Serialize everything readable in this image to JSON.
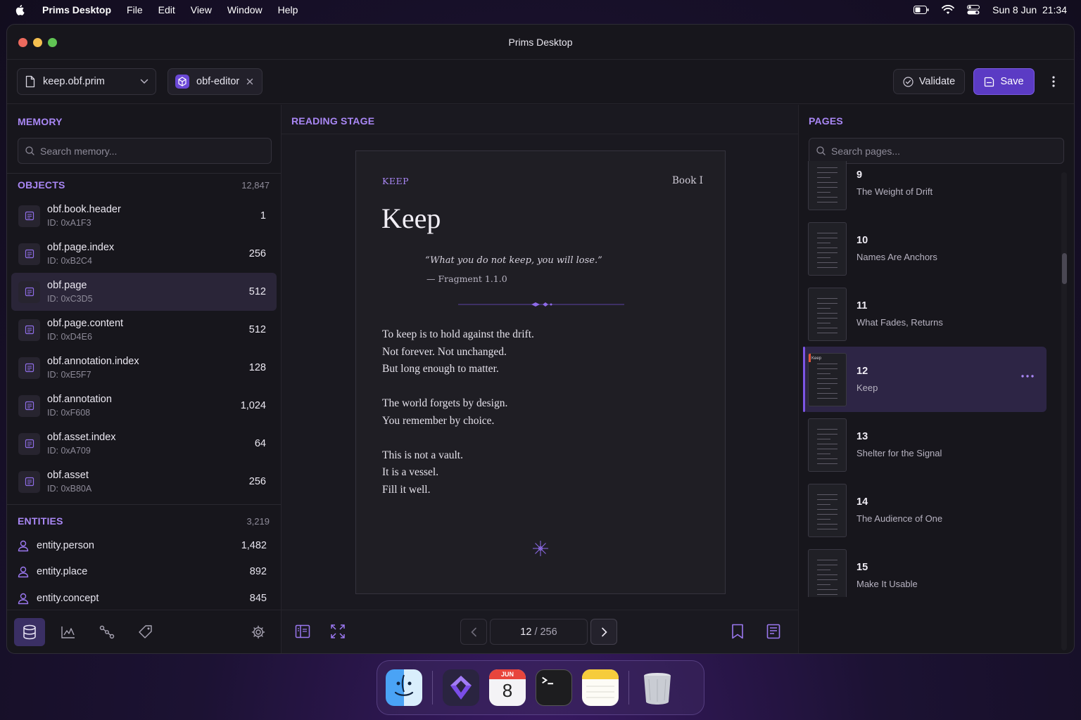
{
  "menubar": {
    "app_name": "Prims Desktop",
    "menus": [
      "File",
      "Edit",
      "View",
      "Window",
      "Help"
    ],
    "clock": "Sun 8 Jun  21:34"
  },
  "window": {
    "title": "Prims Desktop"
  },
  "toolbar": {
    "file_name": "keep.obf.prim",
    "tab_label": "obf-editor",
    "validate_label": "Validate",
    "save_label": "Save"
  },
  "memory": {
    "heading": "MEMORY",
    "search_placeholder": "Search memory...",
    "objects_heading": "OBJECTS",
    "objects_count": "12,847",
    "objects": [
      {
        "name": "obf.book.header",
        "id": "ID: 0xA1F3",
        "value": "1"
      },
      {
        "name": "obf.page.index",
        "id": "ID: 0xB2C4",
        "value": "256"
      },
      {
        "name": "obf.page",
        "id": "ID: 0xC3D5",
        "value": "512"
      },
      {
        "name": "obf.page.content",
        "id": "ID: 0xD4E6",
        "value": "512"
      },
      {
        "name": "obf.annotation.index",
        "id": "ID: 0xE5F7",
        "value": "128"
      },
      {
        "name": "obf.annotation",
        "id": "ID: 0xF608",
        "value": "1,024"
      },
      {
        "name": "obf.asset.index",
        "id": "ID: 0xA709",
        "value": "64"
      },
      {
        "name": "obf.asset",
        "id": "ID: 0xB80A",
        "value": "256"
      }
    ],
    "selected_object_index": 2,
    "entities_heading": "ENTITIES",
    "entities_count": "3,219",
    "entities": [
      {
        "name": "entity.person",
        "value": "1,482"
      },
      {
        "name": "entity.place",
        "value": "892"
      },
      {
        "name": "entity.concept",
        "value": "845"
      }
    ]
  },
  "stage": {
    "heading": "READING STAGE",
    "page": {
      "kicker": "KEEP",
      "book": "Book I",
      "title": "Keep",
      "quote": "“What you do not keep, you will lose.”",
      "attribution": "— Fragment 1.1.0",
      "stanzas": [
        [
          "To keep is to hold against the drift.",
          "Not forever. Not unchanged.",
          "But long enough to matter."
        ],
        [
          "The world forgets by design.",
          "You remember by choice."
        ],
        [
          "This is not a vault.",
          "It is a vessel.",
          "Fill it well."
        ]
      ]
    },
    "pager": {
      "current": "12",
      "total": "/ 256"
    }
  },
  "pages": {
    "heading": "PAGES",
    "search_placeholder": "Search pages...",
    "items": [
      {
        "number": "9",
        "title": "The Weight of Drift"
      },
      {
        "number": "10",
        "title": "Names Are Anchors"
      },
      {
        "number": "11",
        "title": "What Fades, Returns"
      },
      {
        "number": "12",
        "title": "Keep",
        "thumb_label": "Keep"
      },
      {
        "number": "13",
        "title": "Shelter for the Signal"
      },
      {
        "number": "14",
        "title": "The Audience of One"
      },
      {
        "number": "15",
        "title": "Make It Usable"
      }
    ],
    "selected_index": 3
  },
  "colors": {
    "accent": "#a987f5",
    "primary_button": "#5b3bc4",
    "selection": "#2a2538",
    "window_bg": "#17161c"
  },
  "dock": {
    "calendar_month": "JUN",
    "calendar_day": "8",
    "apps": [
      "finder-icon",
      "prims-app-icon",
      "calendar-icon",
      "terminal-icon",
      "notes-icon",
      "trash-icon"
    ]
  }
}
